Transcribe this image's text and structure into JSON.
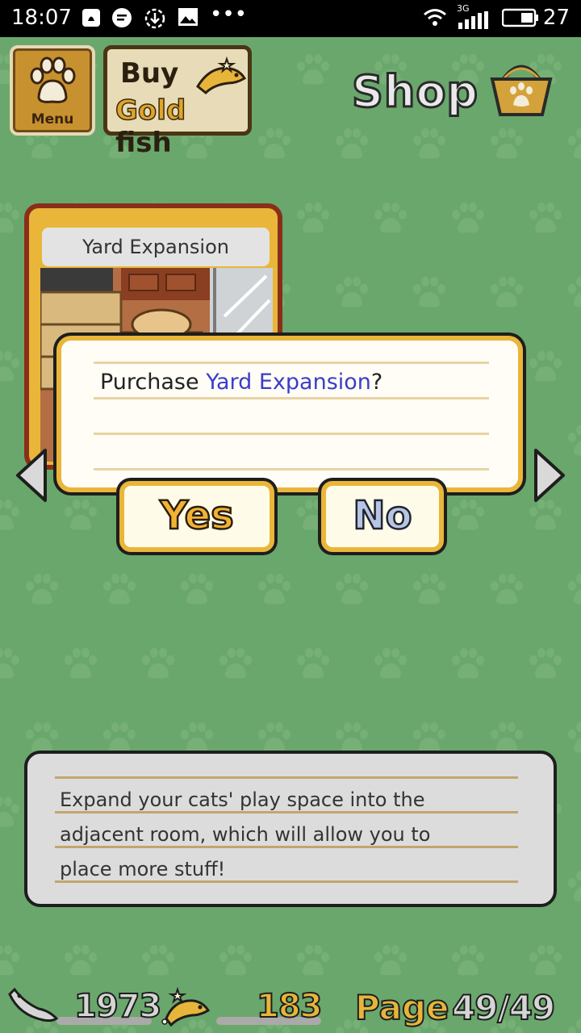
{
  "status_bar": {
    "time": "18:07",
    "network": "3G",
    "battery": "27"
  },
  "top_bar": {
    "menu_label": "Menu",
    "goldfish_line1": "Buy",
    "goldfish_gold": "Gold",
    "goldfish_fish": "fish",
    "title": "Shop"
  },
  "card": {
    "title": "Yard Expansion"
  },
  "dialog": {
    "prefix": "Purchase ",
    "item": "Yard Expansion",
    "suffix": "?",
    "yes_label": "Yes",
    "no_label": "No"
  },
  "description": {
    "line1": "Expand your cats' play space into the",
    "line2": "adjacent room, which will allow you to",
    "line3": "place more stuff!"
  },
  "footer": {
    "silver_fish": "1973",
    "gold_fish": "183",
    "page_label": "Page",
    "page_num": "49/49"
  },
  "colors": {
    "background": "#6aa76c",
    "accent_gold": "#e9b63a",
    "link_blue": "#3b3ec8"
  }
}
